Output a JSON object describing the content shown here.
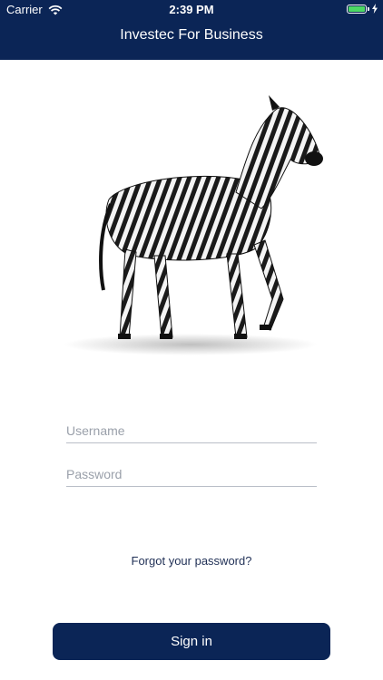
{
  "status_bar": {
    "carrier": "Carrier",
    "time": "2:39 PM",
    "battery_color": "#4cd964"
  },
  "header": {
    "title": "Investec For Business",
    "bg_color": "#0b2556"
  },
  "hero": {
    "icon": "zebra-illustration"
  },
  "login": {
    "username_placeholder": "Username",
    "password_placeholder": "Password",
    "forgot_label": "Forgot your password?",
    "signin_label": "Sign in"
  }
}
